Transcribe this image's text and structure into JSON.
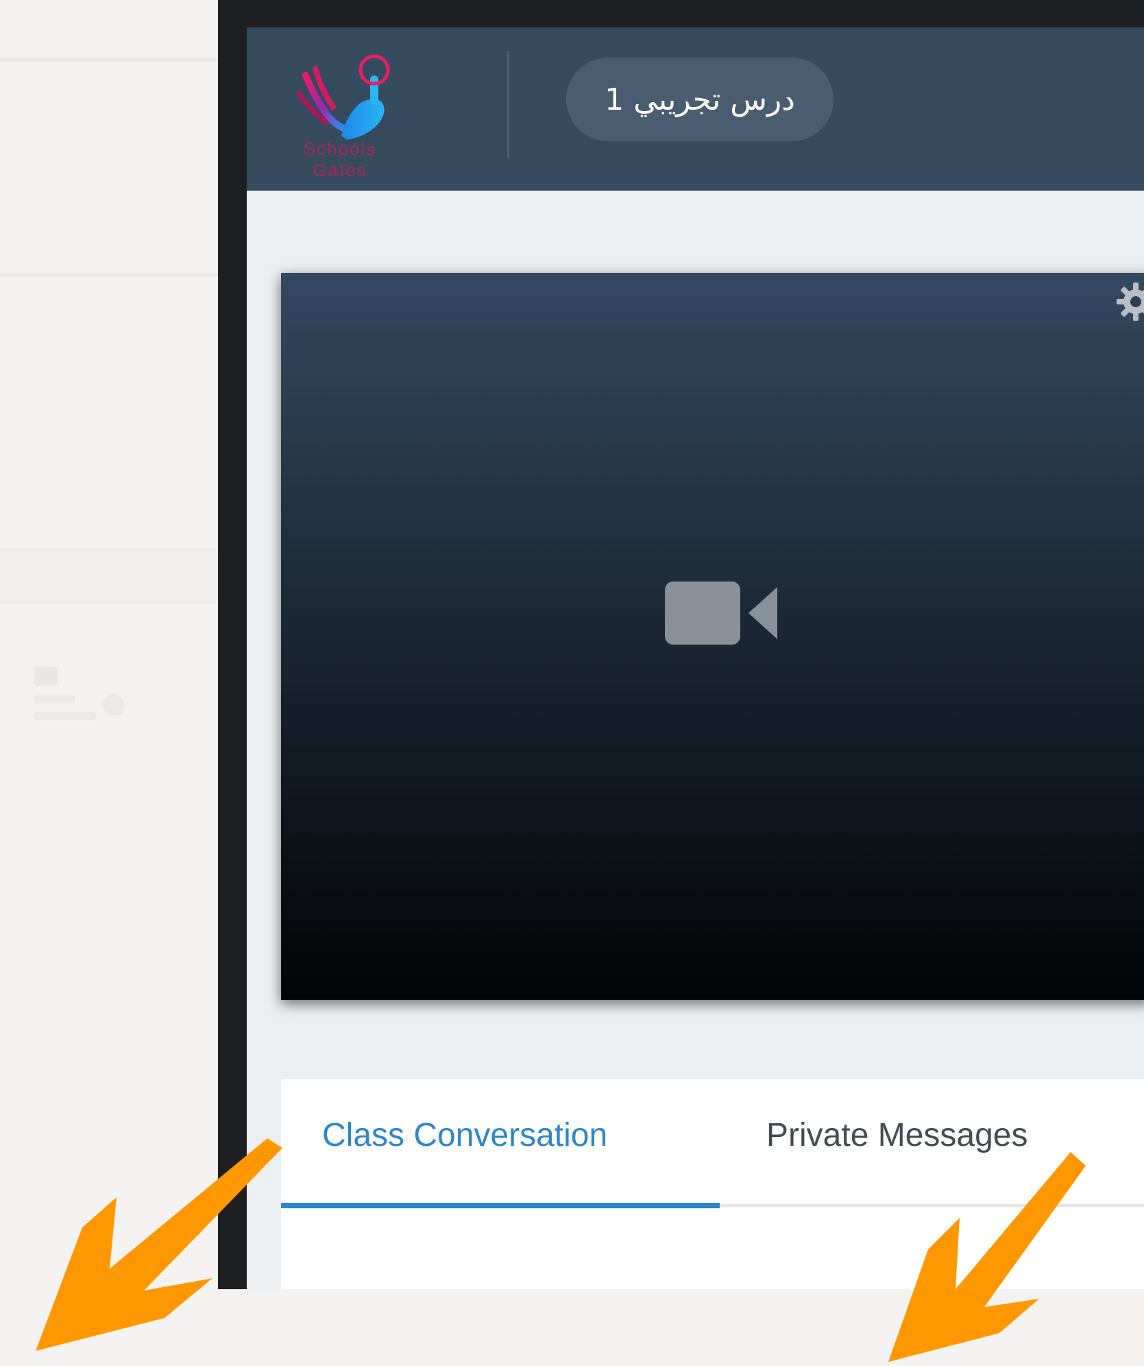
{
  "header": {
    "logo_text": "Schools Gates",
    "lesson_title": "درس تجريبي 1"
  },
  "video": {
    "placeholder_icon": "video-camera-icon",
    "settings_icon": "gear-icon"
  },
  "chat": {
    "tabs": [
      {
        "label": "Class Conversation",
        "active": true
      },
      {
        "label": "Private Messages",
        "active": false
      }
    ]
  },
  "colors": {
    "topbar": "#364a5e",
    "accent": "#2e86c9",
    "annotation": "#ff9800",
    "frame": "#1d1f21"
  },
  "annotations": {
    "arrows": [
      "arrow-down-left-icon",
      "arrow-down-left-icon"
    ]
  }
}
